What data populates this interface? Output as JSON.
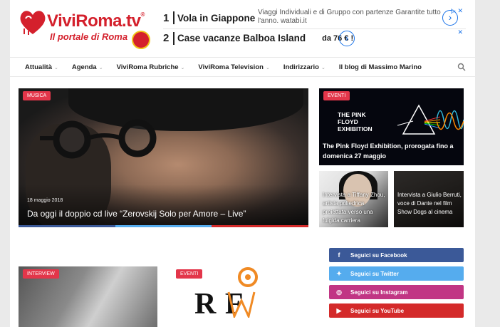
{
  "header": {
    "logo_name": "ViviRoma",
    "logo_tld": ".tv",
    "logo_reg": "®",
    "logo_tagline": "Il portale di Roma"
  },
  "ad": {
    "items": [
      {
        "num": "1",
        "title": "Vola in Giappone",
        "desc": "Viaggi Individuali e di Gruppo con partenze Garantite tutto l'anno.",
        "source": "watabi.it"
      },
      {
        "num": "2",
        "title": "Case vacanze Balboa Island",
        "price": "da 76 € !"
      }
    ]
  },
  "nav": {
    "items": [
      {
        "label": "Attualità",
        "dropdown": true
      },
      {
        "label": "Agenda",
        "dropdown": true
      },
      {
        "label": "ViviRoma Rubriche",
        "dropdown": true
      },
      {
        "label": "ViviRoma Television",
        "dropdown": true
      },
      {
        "label": "Indirizzario",
        "dropdown": true
      },
      {
        "label": "Il blog di Massimo Marino",
        "dropdown": false
      }
    ]
  },
  "hero": {
    "badge": "MUSICA",
    "date": "18 maggio 2018",
    "title": "Da oggi il doppio cd live “Zerovskij Solo per Amore – Live”"
  },
  "pink_floyd": {
    "badge": "EVENTI",
    "poster_title": "THE PINK FLOYD EXHIBITION",
    "caption": "The Pink Floyd Exhibition, prorogata fino a domenica 27 maggio"
  },
  "tiffany": {
    "caption": "Intervista a Tiffany Zhou, artista poliedrica proiettata verso una fulgida carriera"
  },
  "giulio": {
    "caption": "Intervista a Giulio Berruti, voce di Dante nel film Show Dogs al cinema"
  },
  "interview_tile": {
    "badge": "INTERVIEW"
  },
  "events_tile": {
    "badge": "EVENTI",
    "logo_letters": "R F"
  },
  "social": {
    "facebook": "Seguici su Facebook",
    "twitter": "Seguici su Twitter",
    "instagram": "Seguici su Instagram",
    "youtube": "Seguici su YouTube"
  },
  "colors": {
    "brand_red": "#d4202c",
    "badge_red": "#e3364a",
    "ad_blue": "#1a73e8"
  }
}
